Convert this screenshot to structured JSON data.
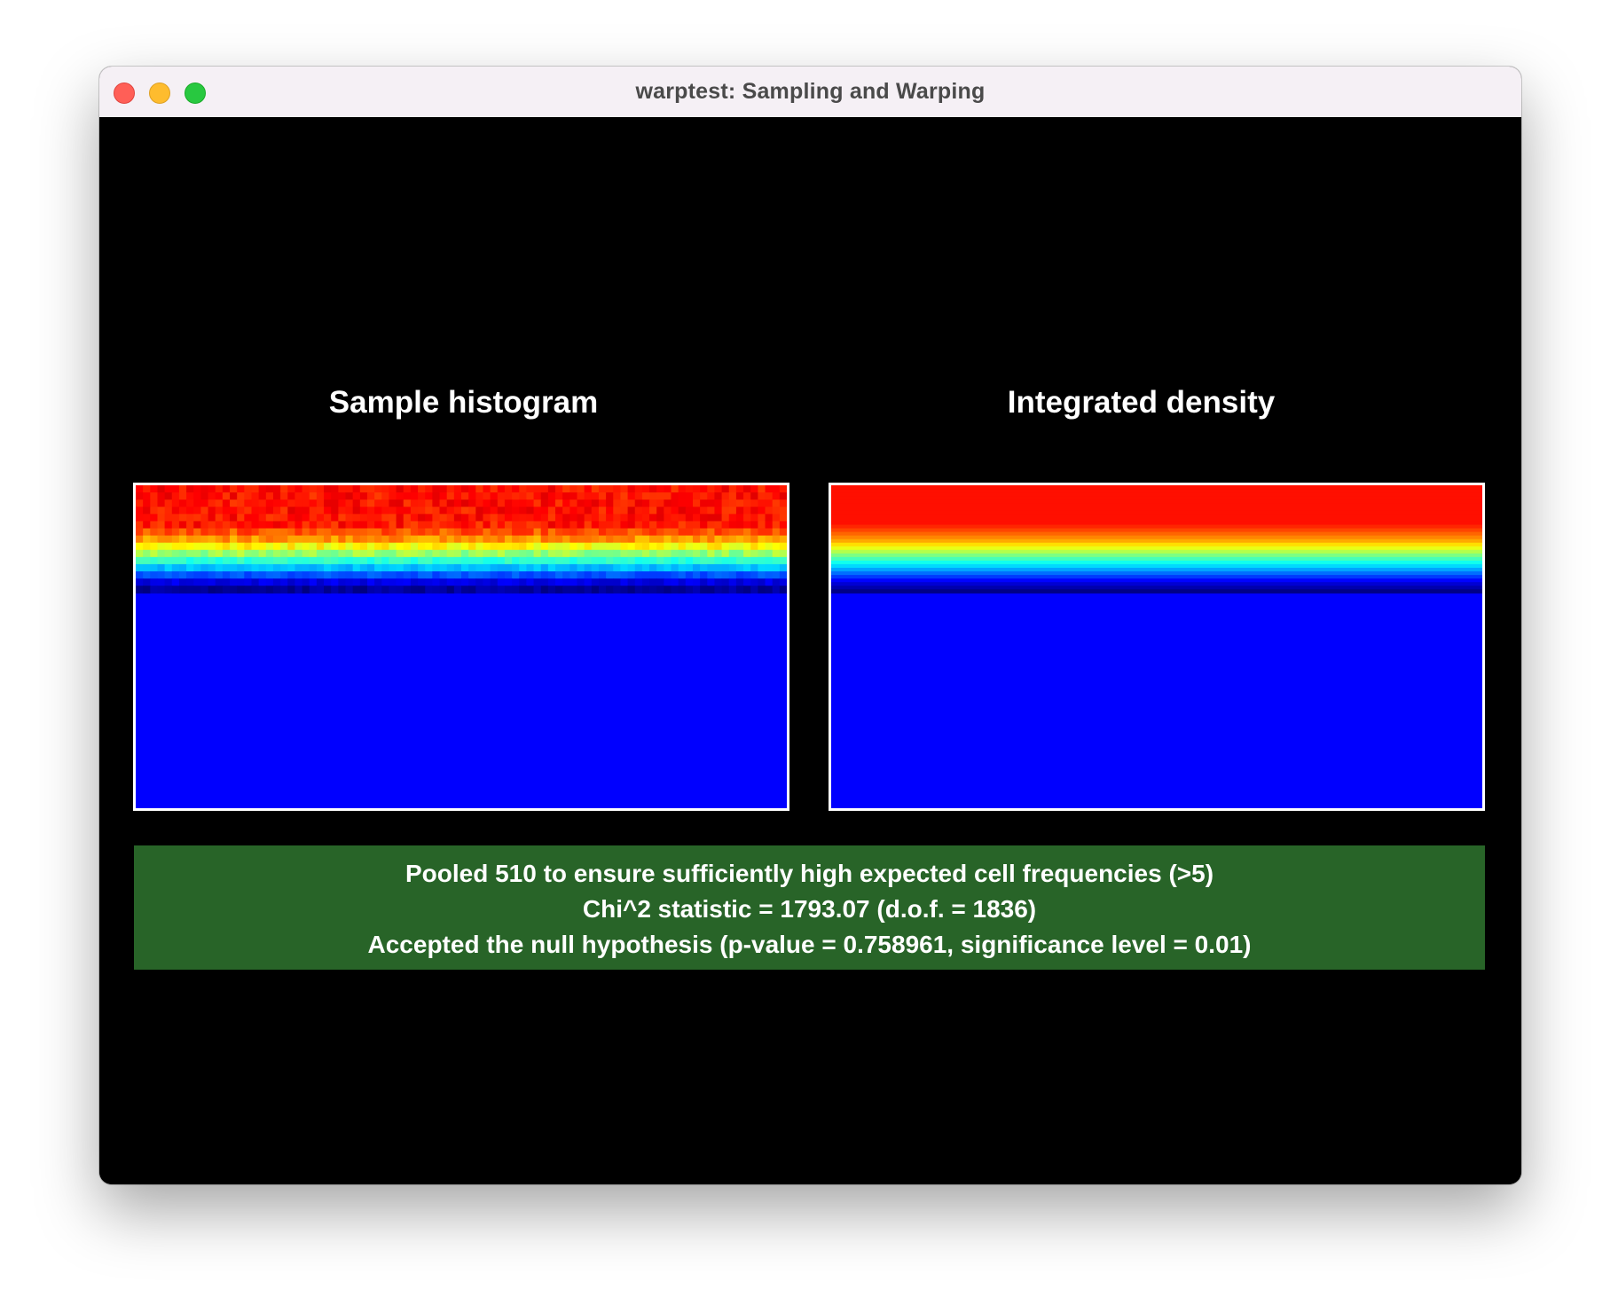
{
  "window": {
    "title": "warptest: Sampling and Warping",
    "traffic_lights": [
      {
        "name": "close-button",
        "color": "#ff5f57",
        "border": "#e0443e"
      },
      {
        "name": "minimize-button",
        "color": "#febc2e",
        "border": "#dea123"
      },
      {
        "name": "zoom-button",
        "color": "#28c840",
        "border": "#1aab29"
      }
    ]
  },
  "panels": {
    "left": {
      "title": "Sample histogram"
    },
    "right": {
      "title": "Integrated density"
    }
  },
  "colormap": {
    "name": "jet",
    "background": "#0000ff"
  },
  "stats": {
    "background": "#286428",
    "line1": "Pooled 510 to ensure sufficiently high expected cell frequencies (>5)",
    "line2": "Chi^2 statistic = 1793.07 (d.o.f. = 1836)",
    "line3": "Accepted the null hypothesis (p-value = 0.758961, significance level = 0.01)"
  }
}
